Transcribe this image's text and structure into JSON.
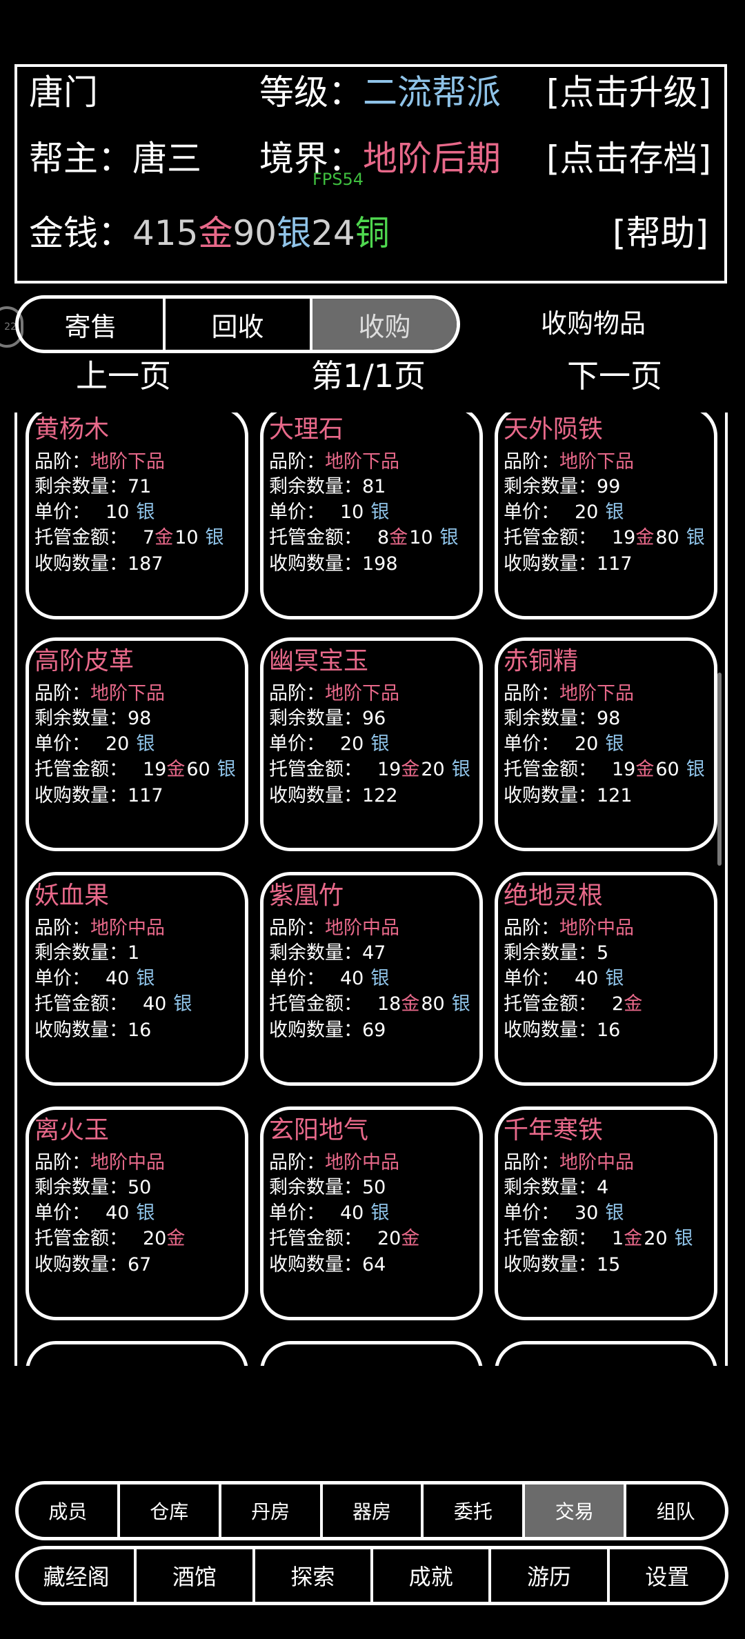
{
  "header": {
    "sect_name": "唐门",
    "level_label": "等级：",
    "level_value": "二流帮派",
    "upgrade_button": "[点击升级]",
    "leader_label": "帮主：",
    "leader_value": "唐三",
    "realm_label": "境界：",
    "realm_value": "地阶后期",
    "save_button": "[点击存档]",
    "fps": "FPS54",
    "money_label": "金钱：",
    "gold_amount": "415",
    "gold_unit": "金",
    "silver_amount": "90",
    "silver_unit": "银",
    "copper_amount": "24",
    "copper_unit": "铜",
    "help_button": "[帮助]"
  },
  "avatar_badge": "22",
  "tabs": {
    "items": [
      "寄售",
      "回收",
      "收购"
    ],
    "active_index": 2,
    "title": "收购物品"
  },
  "pager": {
    "prev": "上一页",
    "current": "第1/1页",
    "next": "下一页"
  },
  "labels": {
    "grade": "品阶：",
    "remaining": "剩余数量：",
    "price": "单价：",
    "escrow": "托管金额：",
    "purchase_qty": "收购数量：",
    "gold": "金",
    "silver": "银"
  },
  "items": [
    {
      "name": "黄杨木",
      "grade": "地阶下品",
      "remaining": "71",
      "price_num": "10",
      "price_unit": "银",
      "escrow_gold": "7",
      "escrow_silver": "10",
      "qty": "187"
    },
    {
      "name": "大理石",
      "grade": "地阶下品",
      "remaining": "81",
      "price_num": "10",
      "price_unit": "银",
      "escrow_gold": "8",
      "escrow_silver": "10",
      "qty": "198"
    },
    {
      "name": "天外陨铁",
      "grade": "地阶下品",
      "remaining": "99",
      "price_num": "20",
      "price_unit": "银",
      "escrow_gold": "19",
      "escrow_silver": "80",
      "qty": "117"
    },
    {
      "name": "高阶皮革",
      "grade": "地阶下品",
      "remaining": "98",
      "price_num": "20",
      "price_unit": "银",
      "escrow_gold": "19",
      "escrow_silver": "60",
      "qty": "117"
    },
    {
      "name": "幽冥宝玉",
      "grade": "地阶下品",
      "remaining": "96",
      "price_num": "20",
      "price_unit": "银",
      "escrow_gold": "19",
      "escrow_silver": "20",
      "qty": "122"
    },
    {
      "name": "赤铜精",
      "grade": "地阶下品",
      "remaining": "98",
      "price_num": "20",
      "price_unit": "银",
      "escrow_gold": "19",
      "escrow_silver": "60",
      "qty": "121"
    },
    {
      "name": "妖血果",
      "grade": "地阶中品",
      "remaining": "1",
      "price_num": "40",
      "price_unit": "银",
      "escrow_gold": "",
      "escrow_silver": "40",
      "qty": "16"
    },
    {
      "name": "紫凰竹",
      "grade": "地阶中品",
      "remaining": "47",
      "price_num": "40",
      "price_unit": "银",
      "escrow_gold": "18",
      "escrow_silver": "80",
      "qty": "69"
    },
    {
      "name": "绝地灵根",
      "grade": "地阶中品",
      "remaining": "5",
      "price_num": "40",
      "price_unit": "银",
      "escrow_gold": "2",
      "escrow_silver": "",
      "qty": "16"
    },
    {
      "name": "离火玉",
      "grade": "地阶中品",
      "remaining": "50",
      "price_num": "40",
      "price_unit": "银",
      "escrow_gold": "20",
      "escrow_silver": "",
      "qty": "67"
    },
    {
      "name": "玄阳地气",
      "grade": "地阶中品",
      "remaining": "50",
      "price_num": "40",
      "price_unit": "银",
      "escrow_gold": "20",
      "escrow_silver": "",
      "qty": "64"
    },
    {
      "name": "千年寒铁",
      "grade": "地阶中品",
      "remaining": "4",
      "price_num": "30",
      "price_unit": "银",
      "escrow_gold": "1",
      "escrow_silver": "20",
      "qty": "15"
    }
  ],
  "nav_row1": {
    "items": [
      "成员",
      "仓库",
      "丹房",
      "器房",
      "委托",
      "交易",
      "组队"
    ],
    "active_index": 5
  },
  "nav_row2": {
    "items": [
      "藏经阁",
      "酒馆",
      "探索",
      "成就",
      "游历",
      "设置"
    ]
  }
}
